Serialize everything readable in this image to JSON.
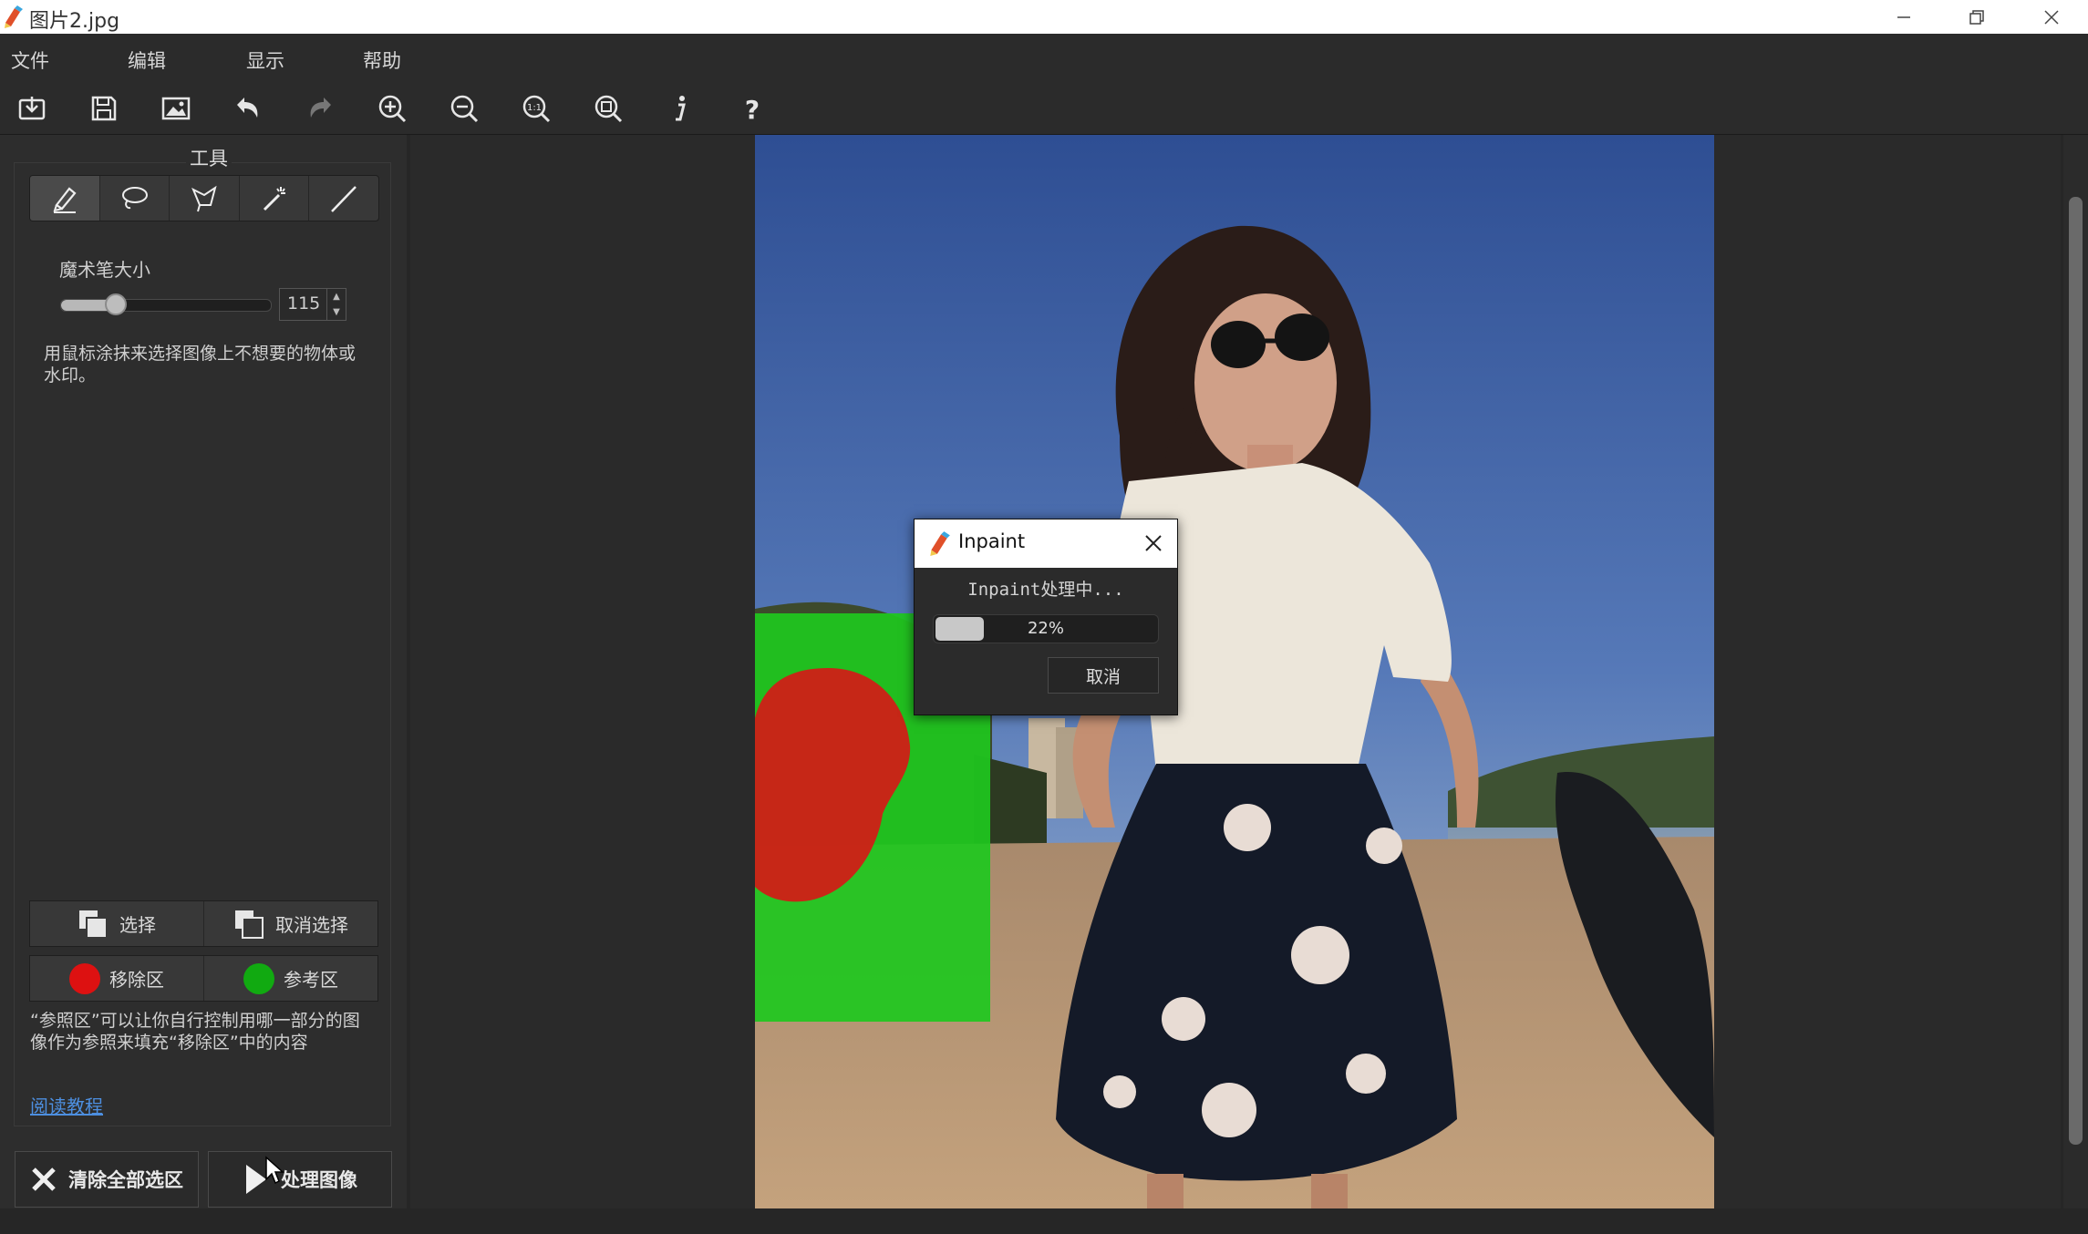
{
  "window": {
    "title": "图片2.jpg",
    "controls": [
      "minimize-icon",
      "restore-icon",
      "close-icon"
    ]
  },
  "menu": [
    "文件",
    "编辑",
    "显示",
    "帮助"
  ],
  "toolbar": {
    "buttons": [
      "open-icon",
      "save-icon",
      "image-icon",
      "undo-icon",
      "redo-icon",
      "zoom-in-icon",
      "zoom-out-icon",
      "actual-size-icon",
      "fit-window-icon",
      "info-icon",
      "help-icon"
    ]
  },
  "tools": {
    "title": "工具",
    "items": [
      "marker-icon",
      "lasso-icon",
      "polygon-lasso-icon",
      "magic-wand-icon",
      "line-icon"
    ],
    "active_index": 0,
    "brush_size_label": "魔术笔大小",
    "brush_size_value": "115",
    "brush_size_fraction": 0.26,
    "hint": "用鼠标涂抹来选择图像上不想要的物体或水印。"
  },
  "selection": {
    "select_label": "选择",
    "deselect_label": "取消选择"
  },
  "regions": {
    "remove_label": "移除区",
    "remove_color": "#dd1111",
    "reference_label": "参考区",
    "reference_color": "#11aa11",
    "description": "“参照区”可以让你自行控制用哪一部分的图像作为参照来填充“移除区”中的内容",
    "tutorial_link": "阅读教程"
  },
  "actions": {
    "clear_label": "清除全部选区",
    "process_label": "处理图像"
  },
  "dialog": {
    "title": "Inpaint",
    "message": "Inpaint处理中...",
    "progress_percent": 22,
    "progress_text": "22%",
    "cancel_label": "取消"
  }
}
